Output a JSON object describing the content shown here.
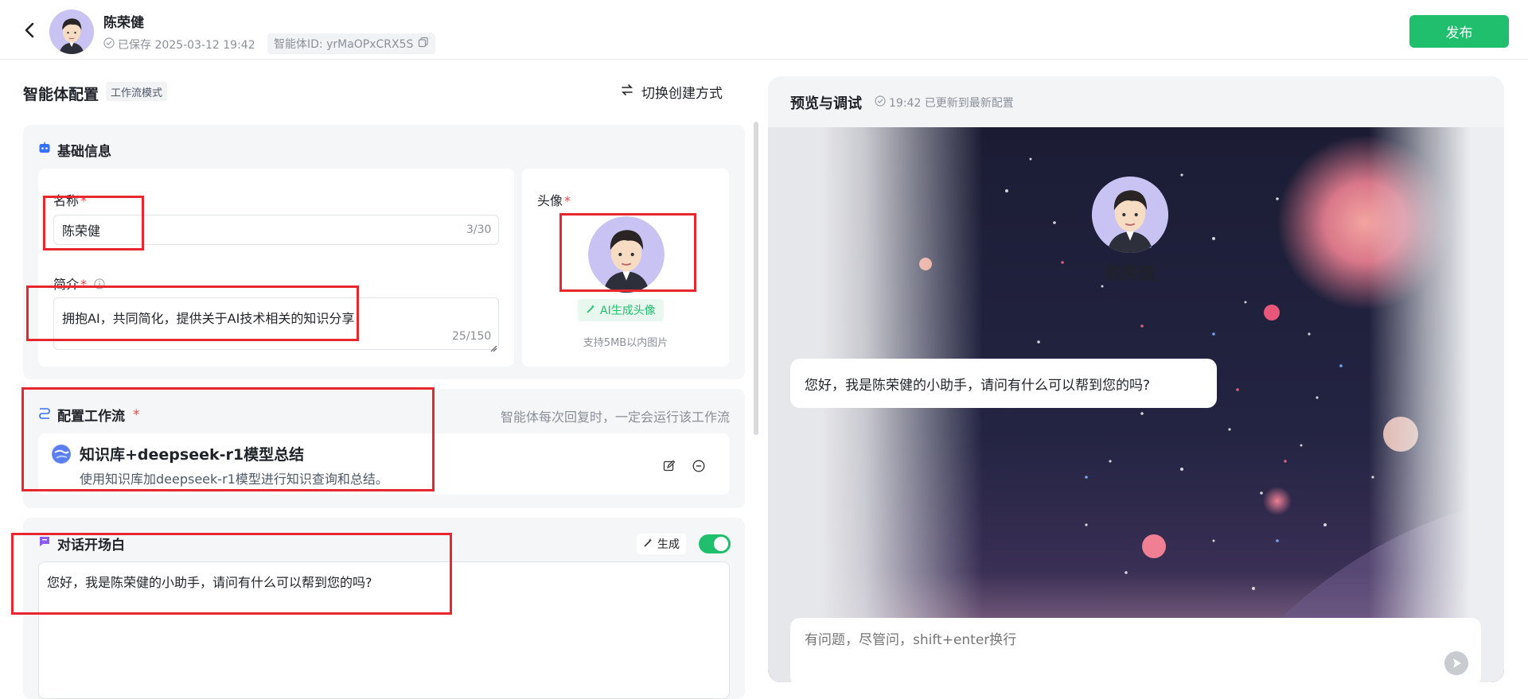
{
  "header": {
    "agent_name": "陈荣健",
    "saved_text": "已保存 2025-03-12 19:42",
    "agent_id_text": "智能体ID: yrMaOPxCRX5S",
    "publish_label": "发布"
  },
  "config": {
    "title": "智能体配置",
    "mode_tag": "工作流模式",
    "switch_label": "切换创建方式"
  },
  "basic_info": {
    "title": "基础信息",
    "name_label": "名称",
    "name_value": "陈荣健",
    "name_counter": "3/30",
    "intro_label": "简介",
    "intro_value": "拥抱AI，共同简化，提供关于AI技术相关的知识分享",
    "intro_counter": "25/150",
    "avatar_label": "头像",
    "ai_avatar_label": "AI生成头像",
    "avatar_hint": "支持5MB以内图片"
  },
  "workflow": {
    "title": "配置工作流",
    "hint": "智能体每次回复时，一定会运行该工作流",
    "item_title": "知识库+deepseek-r1模型总结",
    "item_desc": "使用知识库加deepseek-r1模型进行知识查询和总结。"
  },
  "opener": {
    "title": "对话开场白",
    "generate_label": "生成",
    "enabled": true,
    "text": "您好，我是陈荣健的小助手，请问有什么可以帮到您的吗?"
  },
  "preview": {
    "title": "预览与调试",
    "status": "19:42 已更新到最新配置",
    "agent_name": "陈荣健",
    "greeting": "您好，我是陈荣健的小助手，请问有什么可以帮到您的吗?",
    "input_placeholder": "有问题，尽管问，shift+enter换行"
  },
  "colors": {
    "accent": "#1fbf6e",
    "annotation_red": "#e8262e"
  }
}
